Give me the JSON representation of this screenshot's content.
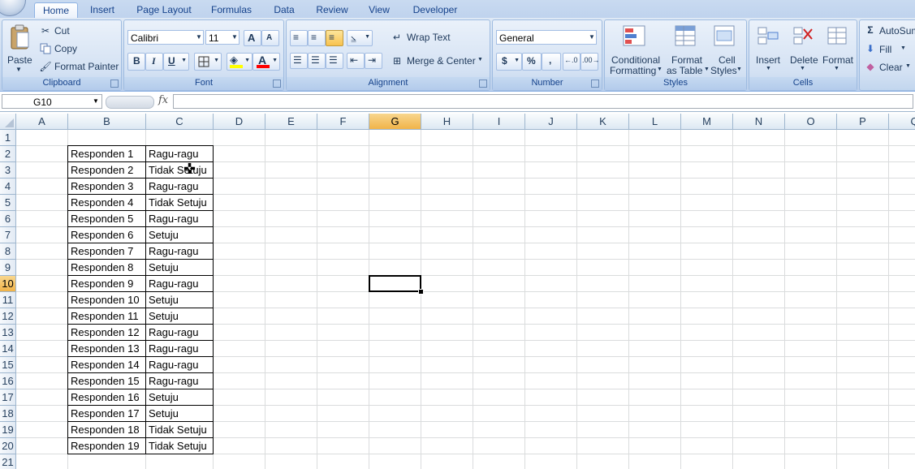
{
  "tabs": [
    {
      "label": "Home",
      "active": true
    },
    {
      "label": "Insert"
    },
    {
      "label": "Page Layout"
    },
    {
      "label": "Formulas"
    },
    {
      "label": "Data"
    },
    {
      "label": "Review"
    },
    {
      "label": "View"
    },
    {
      "label": "Developer"
    }
  ],
  "clipboard": {
    "group": "Clipboard",
    "paste": "Paste",
    "cut": "Cut",
    "copy": "Copy",
    "format_painter": "Format Painter"
  },
  "font": {
    "group": "Font",
    "name": "Calibri",
    "size": "11",
    "bold": "B",
    "italic": "I",
    "underline": "U",
    "grow": "A",
    "shrink": "A",
    "font_color": "A"
  },
  "alignment": {
    "group": "Alignment",
    "wrap": "Wrap Text",
    "merge": "Merge & Center"
  },
  "number": {
    "group": "Number",
    "format": "General",
    "currency": "$",
    "percent": "%",
    "comma": ","
  },
  "styles": {
    "group": "Styles",
    "conditional_1": "Conditional",
    "conditional_2": "Formatting",
    "format_table_1": "Format",
    "format_table_2": "as Table",
    "cell_styles_1": "Cell",
    "cell_styles_2": "Styles"
  },
  "cells": {
    "group": "Cells",
    "insert": "Insert",
    "delete": "Delete",
    "format": "Format"
  },
  "editing": {
    "autosum": "AutoSum",
    "fill": "Fill",
    "clear": "Clear"
  },
  "formula_bar": {
    "name_box": "G10",
    "fx": "fx",
    "value": ""
  },
  "columns": [
    "A",
    "B",
    "C",
    "D",
    "E",
    "F",
    "G",
    "H",
    "I",
    "J",
    "K",
    "L",
    "M",
    "N",
    "O",
    "P",
    "Q"
  ],
  "rows": [
    "1",
    "2",
    "3",
    "4",
    "5",
    "6",
    "7",
    "8",
    "9",
    "10",
    "11",
    "12",
    "13",
    "14",
    "15",
    "16",
    "17",
    "18",
    "19",
    "20",
    "21"
  ],
  "selected": {
    "column": "G",
    "row": "10"
  },
  "table": [
    [
      "Responden 1",
      "Ragu-ragu"
    ],
    [
      "Responden 2",
      "Tidak Setuju"
    ],
    [
      "Responden 3",
      "Ragu-ragu"
    ],
    [
      "Responden 4",
      "Tidak Setuju"
    ],
    [
      "Responden 5",
      "Ragu-ragu"
    ],
    [
      "Responden 6",
      "Setuju"
    ],
    [
      "Responden 7",
      "Ragu-ragu"
    ],
    [
      "Responden 8",
      "Setuju"
    ],
    [
      "Responden 9",
      "Ragu-ragu"
    ],
    [
      "Responden 10",
      "Setuju"
    ],
    [
      "Responden 11",
      "Setuju"
    ],
    [
      "Responden 12",
      "Ragu-ragu"
    ],
    [
      "Responden 13",
      "Ragu-ragu"
    ],
    [
      "Responden 14",
      "Ragu-ragu"
    ],
    [
      "Responden 15",
      "Ragu-ragu"
    ],
    [
      "Responden 16",
      "Setuju"
    ],
    [
      "Responden 17",
      "Setuju"
    ],
    [
      "Responden 18",
      "Tidak Setuju"
    ],
    [
      "Responden 19",
      "Tidak Setuju"
    ]
  ]
}
